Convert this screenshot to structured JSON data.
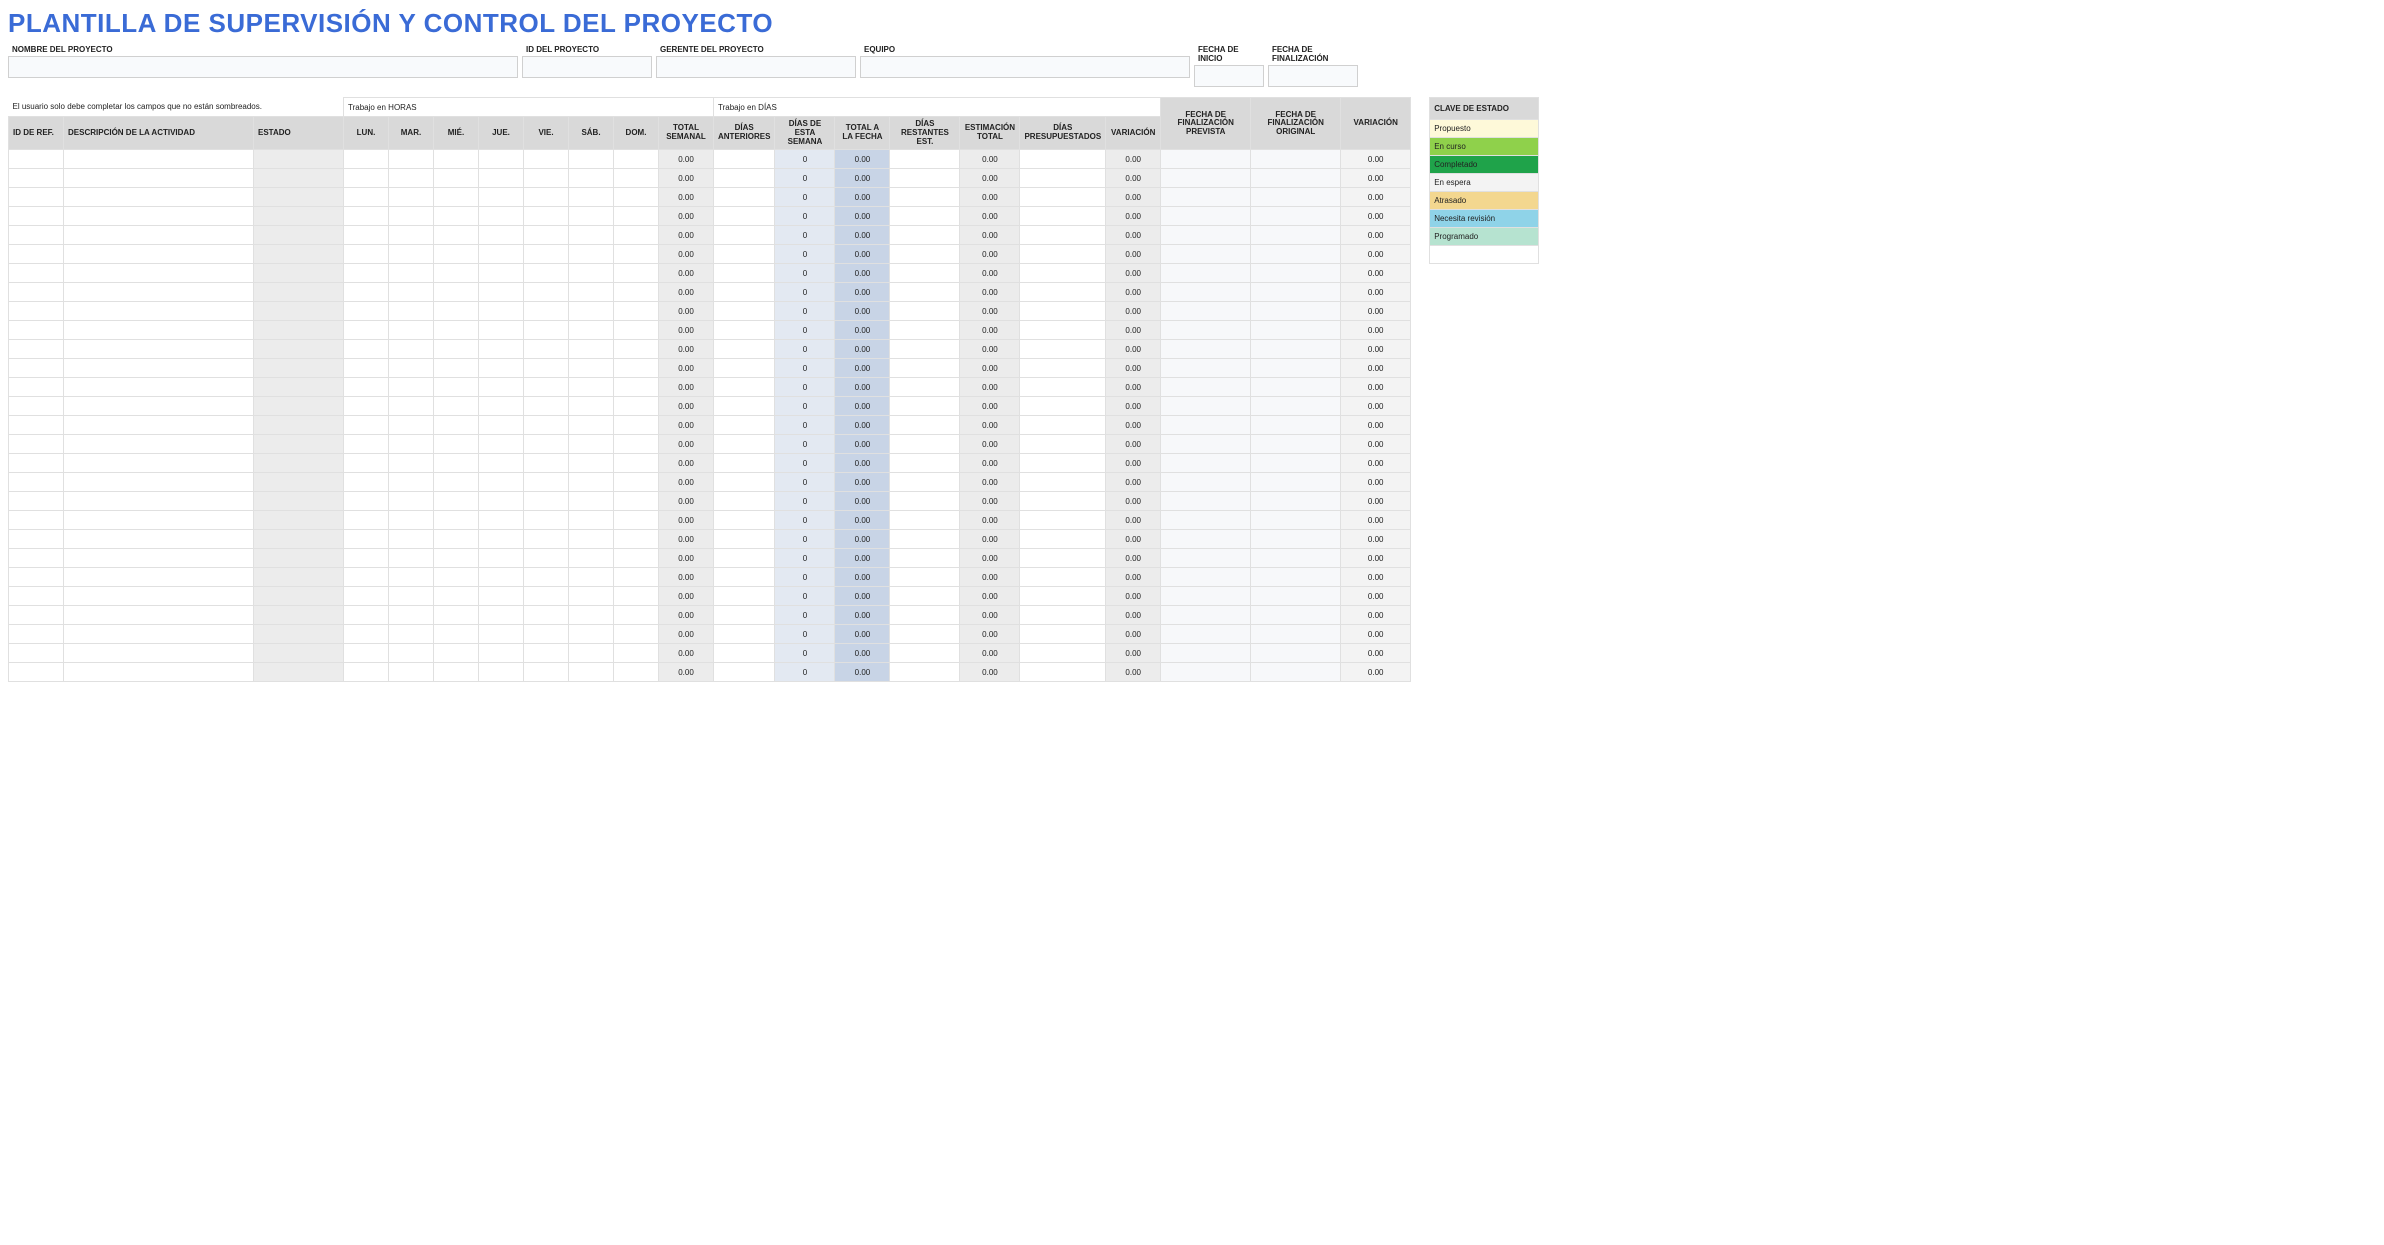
{
  "title": "PLANTILLA DE SUPERVISIÓN Y CONTROL DEL PROYECTO",
  "meta": {
    "project_name_label": "NOMBRE DEL PROYECTO",
    "project_id_label": "ID DEL PROYECTO",
    "pm_label": "GERENTE DEL PROYECTO",
    "team_label": "EQUIPO",
    "start_label": "FECHA DE INICIO",
    "end_label": "FECHA DE FINALIZACIÓN",
    "project_name": "",
    "project_id": "",
    "pm": "",
    "team": "",
    "start": "",
    "end": ""
  },
  "note": "El usuario solo debe completar los campos que no están sombreados.",
  "sections": {
    "hours": "Trabajo en HORAS",
    "days": "Trabajo en DÍAS"
  },
  "headers": {
    "ref": "ID DE REF.",
    "desc": "DESCRIPCIÓN DE LA ACTIVIDAD",
    "estado": "ESTADO",
    "lun": "LUN.",
    "mar": "MAR.",
    "mie": "MIÉ.",
    "jue": "JUE.",
    "vie": "VIE.",
    "sab": "SÁB.",
    "dom": "DOM.",
    "total_sem": "TOTAL SEMANAL",
    "dias_ant": "DÍAS ANTERIORES",
    "dias_esta": "DÍAS DE ESTA SEMANA",
    "total_fecha": "TOTAL A LA FECHA",
    "dias_rest": "DÍAS RESTANTES EST.",
    "est_total": "ESTIMACIÓN TOTAL",
    "dias_pres": "DÍAS PRESUPUESTADOS",
    "variacion": "VARIACIÓN",
    "fecha_prev": "FECHA DE FINALIZACIÓN PREVISTA",
    "fecha_orig": "FECHA DE FINALIZACIÓN ORIGINAL",
    "variacion2": "VARIACIÓN"
  },
  "row_defaults": {
    "total_sem": "0.00",
    "dias_esta": "0",
    "total_fecha": "0.00",
    "est_total": "0.00",
    "variacion": "0.00",
    "variacion2": "0.00"
  },
  "row_count": 28,
  "legend": {
    "title": "CLAVE DE ESTADO",
    "items": [
      {
        "label": "Propuesto",
        "color": "#fef9d9"
      },
      {
        "label": "En curso",
        "color": "#8fd14b"
      },
      {
        "label": "Completado",
        "color": "#1fa34a"
      },
      {
        "label": "En espera",
        "color": "#f3f3f3"
      },
      {
        "label": "Atrasado",
        "color": "#f3d78f"
      },
      {
        "label": "Necesita revisión",
        "color": "#8fd3e8"
      },
      {
        "label": "Programado",
        "color": "#b6e3d0"
      }
    ]
  }
}
